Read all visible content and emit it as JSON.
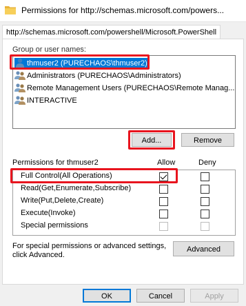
{
  "window": {
    "title": "Permissions for http://schemas.microsoft.com/powers..."
  },
  "tab": {
    "label": "http://schemas.microsoft.com/powershell/Microsoft.PowerShell"
  },
  "groups": {
    "label": "Group or user names:",
    "items": [
      {
        "name": "thmuser2 (PURECHAOS\\thmuser2)",
        "icon": "user-icon",
        "selected": true
      },
      {
        "name": "Administrators (PURECHAOS\\Administrators)",
        "icon": "group-icon",
        "selected": false
      },
      {
        "name": "Remote Management Users (PURECHAOS\\Remote Manag...",
        "icon": "group-icon",
        "selected": false
      },
      {
        "name": "INTERACTIVE",
        "icon": "group-icon",
        "selected": false
      }
    ]
  },
  "buttons": {
    "add": "Add...",
    "remove": "Remove",
    "advanced": "Advanced",
    "ok": "OK",
    "cancel": "Cancel",
    "apply": "Apply"
  },
  "permissions": {
    "header": "Permissions for thmuser2",
    "allow_header": "Allow",
    "deny_header": "Deny",
    "rows": [
      {
        "name": "Full Control(All Operations)",
        "allow": true,
        "deny": false,
        "disabled": false
      },
      {
        "name": "Read(Get,Enumerate,Subscribe)",
        "allow": false,
        "deny": false,
        "disabled": false
      },
      {
        "name": "Write(Put,Delete,Create)",
        "allow": false,
        "deny": false,
        "disabled": false
      },
      {
        "name": "Execute(Invoke)",
        "allow": false,
        "deny": false,
        "disabled": false
      },
      {
        "name": "Special permissions",
        "allow": false,
        "deny": false,
        "disabled": true
      }
    ]
  },
  "advanced_note": {
    "line1": "For special permissions or advanced settings,",
    "line2": "click Advanced."
  },
  "colors": {
    "highlight": "#e8141e",
    "selection": "#0078d7"
  }
}
